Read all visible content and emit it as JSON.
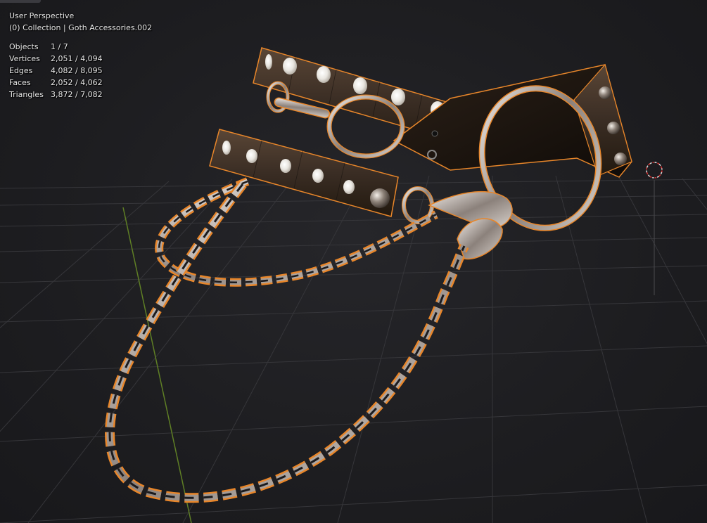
{
  "viewport": {
    "view_name": "User Perspective",
    "collection_info": "(0) Collection | Goth Accessories.002",
    "statistics": [
      {
        "label": "Objects",
        "value": "1 / 7"
      },
      {
        "label": "Vertices",
        "value": "2,051 / 4,094"
      },
      {
        "label": "Edges",
        "value": "4,082 / 8,095"
      },
      {
        "label": "Faces",
        "value": "2,052 / 4,062"
      },
      {
        "label": "Triangles",
        "value": "3,872 / 7,082"
      }
    ]
  },
  "colors": {
    "background": "#1d1d20",
    "grid": "#3a3a3e",
    "y_axis": "#6a8a2a",
    "selection_outline": "#e8862a",
    "strap": "#3d3128",
    "metal": "#c9c3c0"
  },
  "icons": [
    "3d-cursor-icon"
  ]
}
